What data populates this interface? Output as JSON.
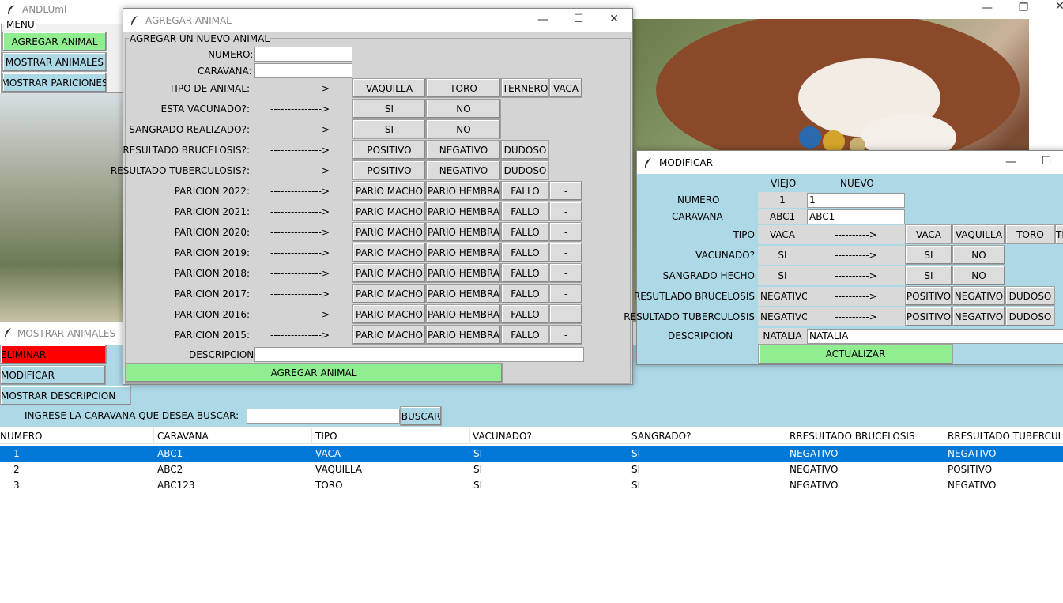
{
  "main_window": {
    "title": "ANDLUml",
    "menu_label": "MENU",
    "menu_buttons": [
      "AGREGAR ANIMAL",
      "MOSTRAR ANIMALES",
      "MOSTRAR PARICIONES"
    ]
  },
  "agregar": {
    "title": "AGREGAR ANIMAL",
    "frame_label": "AGREGAR UN NUEVO ANIMAL",
    "numero_label": "NUMERO:",
    "caravana_label": "CARAVANA:",
    "arrow": "--------------->",
    "rows": [
      {
        "label": "TIPO DE ANIMAL:",
        "options": [
          "VAQUILLA",
          "TORO",
          "TERNERO",
          "VACA"
        ]
      },
      {
        "label": "ESTA VACUNADO?:",
        "options": [
          "SI",
          "NO"
        ]
      },
      {
        "label": "SANGRADO REALIZADO?:",
        "options": [
          "SI",
          "NO"
        ]
      },
      {
        "label": "RESULTADO BRUCELOSIS?:",
        "options": [
          "POSITIVO",
          "NEGATIVO",
          "DUDOSO"
        ]
      },
      {
        "label": "RESULTADO TUBERCULOSIS?:",
        "options": [
          "POSITIVO",
          "NEGATIVO",
          "DUDOSO"
        ]
      },
      {
        "label": "PARICION 2022:",
        "options": [
          "PARIO MACHO",
          "PARIO HEMBRA",
          "FALLO",
          "-"
        ]
      },
      {
        "label": "PARICION 2021:",
        "options": [
          "PARIO MACHO",
          "PARIO HEMBRA",
          "FALLO",
          "-"
        ]
      },
      {
        "label": "PARICION 2020:",
        "options": [
          "PARIO MACHO",
          "PARIO HEMBRA",
          "FALLO",
          "-"
        ]
      },
      {
        "label": "PARICION 2019:",
        "options": [
          "PARIO MACHO",
          "PARIO HEMBRA",
          "FALLO",
          "-"
        ]
      },
      {
        "label": "PARICION 2018:",
        "options": [
          "PARIO MACHO",
          "PARIO HEMBRA",
          "FALLO",
          "-"
        ]
      },
      {
        "label": "PARICION 2017:",
        "options": [
          "PARIO MACHO",
          "PARIO HEMBRA",
          "FALLO",
          "-"
        ]
      },
      {
        "label": "PARICION 2016:",
        "options": [
          "PARIO MACHO",
          "PARIO HEMBRA",
          "FALLO",
          "-"
        ]
      },
      {
        "label": "PARICION 2015:",
        "options": [
          "PARIO MACHO",
          "PARIO HEMBRA",
          "FALLO",
          "-"
        ]
      }
    ],
    "descripcion_label": "DESCRIPCION:",
    "submit": "AGREGAR ANIMAL"
  },
  "mostrar": {
    "title": "MOSTRAR ANIMALES",
    "eliminar": "ELIMINAR",
    "modificar": "MODIFICAR",
    "mostrar_desc": "MOSTRAR DESCRIPCION",
    "search_label": "INGRESE LA CARAVANA QUE DESEA BUSCAR:",
    "search_value": "",
    "buscar": "BUSCAR",
    "columns": [
      "NUMERO",
      "CARAVANA",
      "TIPO",
      "VACUNADO?",
      "SANGRADO?",
      "RRESULTADO BRUCELOSIS",
      "RRESULTADO TUBERCULOSIS"
    ],
    "rows": [
      [
        "1",
        "ABC1",
        "VACA",
        "SI",
        "SI",
        "NEGATIVO",
        "NEGATIVO"
      ],
      [
        "2",
        "ABC2",
        "VAQUILLA",
        "SI",
        "SI",
        "NEGATIVO",
        "POSITIVO"
      ],
      [
        "3",
        "ABC123",
        "TORO",
        "SI",
        "SI",
        "NEGATIVO",
        "NEGATIVO"
      ]
    ]
  },
  "modificar": {
    "title": "MODIFICAR",
    "viejo": "VIEJO",
    "nuevo": "NUEVO",
    "arrow": "---------->",
    "numero_label": "NUMERO",
    "numero_old": "1",
    "numero_new": "1",
    "caravana_label": "CARAVANA",
    "caravana_old": "ABC1",
    "caravana_new": "ABC1",
    "rows": [
      {
        "label": "TIPO",
        "old": "VACA",
        "options": [
          "VACA",
          "VAQUILLA",
          "TORO",
          "TE"
        ]
      },
      {
        "label": "VACUNADO?",
        "old": "SI",
        "options": [
          "SI",
          "NO"
        ]
      },
      {
        "label": "SANGRADO HECHO",
        "old": "SI",
        "options": [
          "SI",
          "NO"
        ]
      },
      {
        "label": "RESUTLADO BRUCELOSIS",
        "old": "NEGATIVO",
        "options": [
          "POSITIVO",
          "NEGATIVO",
          "DUDOSO"
        ]
      },
      {
        "label": "RESULTADO TUBERCULOSIS",
        "old": "NEGATIVO",
        "options": [
          "POSITIVO",
          "NEGATIVO",
          "DUDOSO"
        ]
      }
    ],
    "descripcion_label": "DESCRIPCION",
    "descripcion_old": "NATALIA",
    "descripcion_new": "NATALIA",
    "actualizar": "ACTUALIZAR"
  },
  "colors": {
    "green": "#90ee90",
    "lightblue": "#add8e6",
    "red": "#ff0000",
    "gray": "#d9d9d9",
    "select": "#0078d7"
  }
}
